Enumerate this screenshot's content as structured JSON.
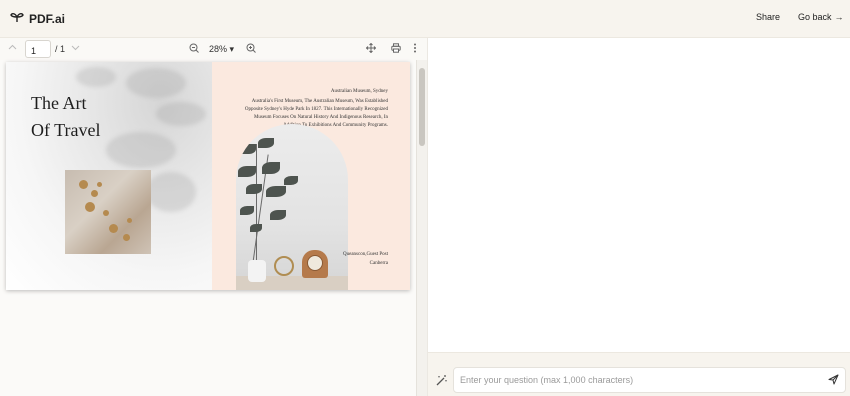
{
  "header": {
    "app_name": "PDF.ai",
    "share_label": "Share",
    "go_back_label": "Go back",
    "go_back_arrow": "→"
  },
  "viewer_toolbar": {
    "page_number": "1",
    "page_total": "/ 1",
    "zoom": "28%",
    "zoom_caret": "▾",
    "icons": [
      "chevron-up-icon",
      "chevron-down-icon",
      "zoom-out-icon",
      "zoom-in-icon",
      "pan-icon",
      "print-icon",
      "more-icon"
    ]
  },
  "pdf_page": {
    "title_line1": "The Art",
    "title_line2": "Of Travel",
    "caption_heading": "Australian Museum, Sydney",
    "caption_body": "Australia's First Museum, The Australian Museum, Was Established Opposite Sydney's Hyde Park In 1827. This Internationally Recognized Museum Focuses On Natural History And Indigenous Research, In Addition To Exhibitions And Community Programs.",
    "caption2_line1": "Queanscon,Guest Post",
    "caption2_line2": "Canberra"
  },
  "chat": {
    "placeholder": "Enter your question (max 1,000 characters)",
    "input_value": ""
  },
  "colors": {
    "header_bg": "#f7f4ee",
    "pdf_right_bg": "#fbe9df"
  }
}
